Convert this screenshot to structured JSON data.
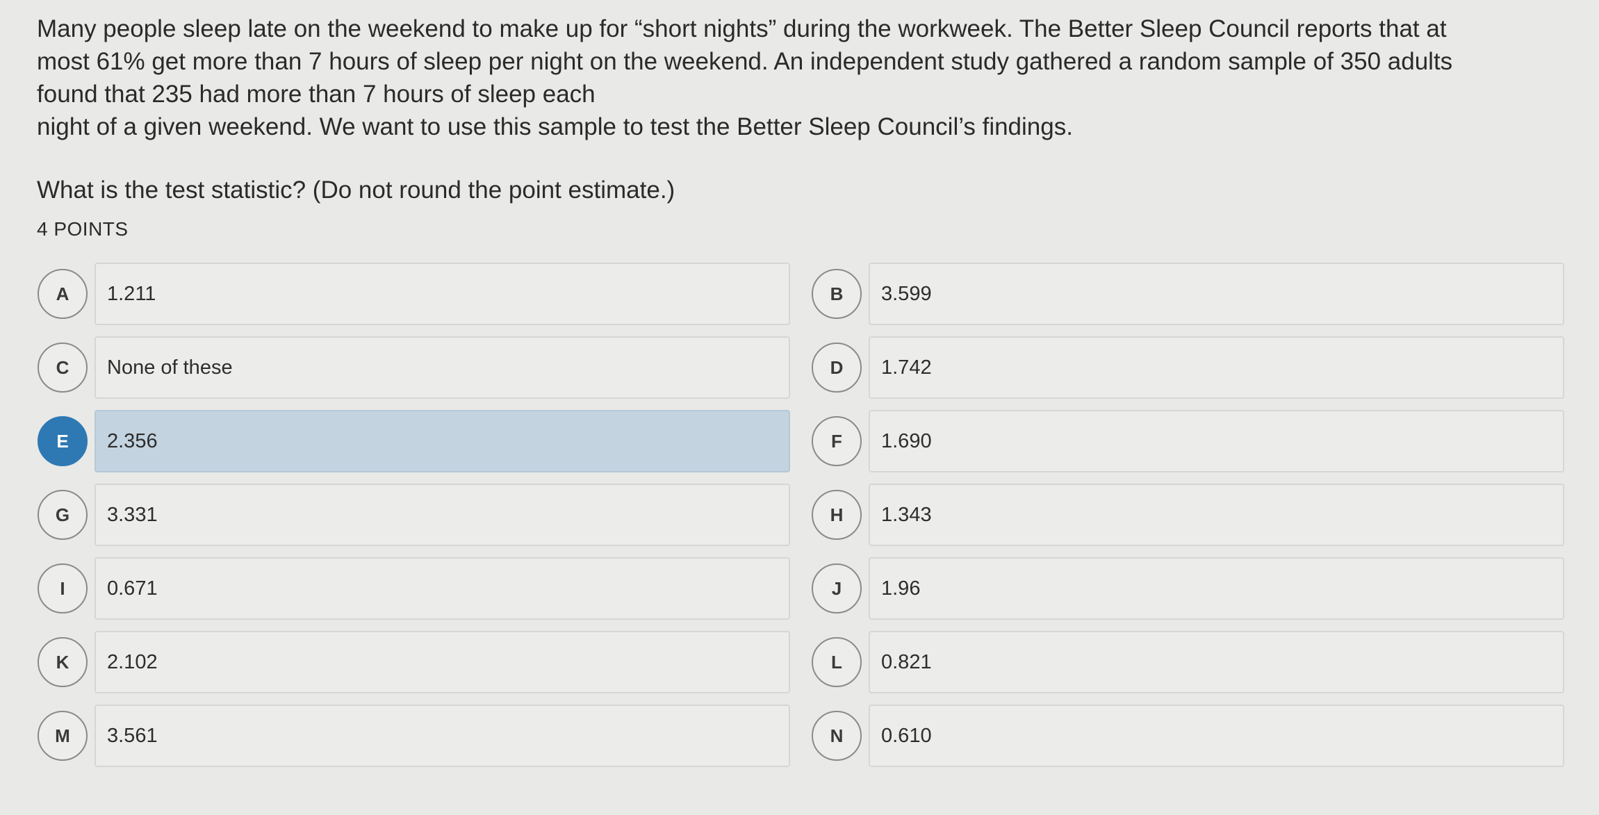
{
  "question": {
    "lines": [
      "Many people sleep late on the weekend to make up for “short nights” during the workweek.  The Better Sleep Council reports that at",
      "most 61% get more than 7 hours of sleep per night on the weekend.  An independent study gathered a random sample of 350 adults",
      "found that 235 had more than 7 hours of sleep each",
      "night of a given weekend.  We want to use this sample to test the Better Sleep Council’s findings."
    ],
    "prompt": "What is the test statistic?  (Do not round the point estimate.)",
    "points": "4 POINTS"
  },
  "options": [
    {
      "letter": "A",
      "value": "1.211",
      "selected": false
    },
    {
      "letter": "B",
      "value": "3.599",
      "selected": false
    },
    {
      "letter": "C",
      "value": "None of these",
      "selected": false
    },
    {
      "letter": "D",
      "value": "1.742",
      "selected": false
    },
    {
      "letter": "E",
      "value": "2.356",
      "selected": true
    },
    {
      "letter": "F",
      "value": "1.690",
      "selected": false
    },
    {
      "letter": "G",
      "value": "3.331",
      "selected": false
    },
    {
      "letter": "H",
      "value": "1.343",
      "selected": false
    },
    {
      "letter": "I",
      "value": "0.671",
      "selected": false
    },
    {
      "letter": "J",
      "value": "1.96",
      "selected": false
    },
    {
      "letter": "K",
      "value": "2.102",
      "selected": false
    },
    {
      "letter": "L",
      "value": "0.821",
      "selected": false
    },
    {
      "letter": "M",
      "value": "3.561",
      "selected": false
    },
    {
      "letter": "N",
      "value": "0.610",
      "selected": false
    }
  ],
  "colors": {
    "selected_badge": "#2e79b4",
    "selected_box": "#c3d3e0",
    "background": "#e9e9e7"
  }
}
